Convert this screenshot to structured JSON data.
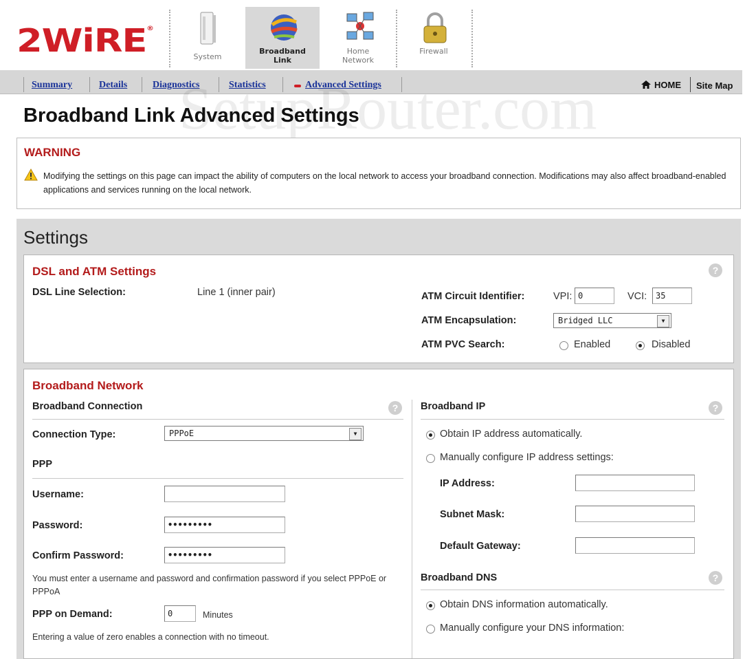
{
  "brand": {
    "logo_text": "2WiRE",
    "reg_mark": "®"
  },
  "main_nav": [
    {
      "label_line1": "System",
      "label_line2": ""
    },
    {
      "label_line1": "Broadband",
      "label_line2": "Link"
    },
    {
      "label_line1": "Home",
      "label_line2": "Network"
    },
    {
      "label_line1": "Firewall",
      "label_line2": ""
    }
  ],
  "sub_nav": {
    "items": [
      "Summary",
      "Details",
      "Diagnostics",
      "Statistics",
      "Advanced Settings"
    ],
    "home": "HOME",
    "site_map": "Site Map"
  },
  "watermark": "SetupRouter.com",
  "page_title": "Broadband Link Advanced Settings",
  "warning": {
    "title": "WARNING",
    "text": "Modifying the settings on this page can impact the ability of computers on the local network to access your broadband connection. Modifications may also affect broadband-enabled applications and services running on the local network."
  },
  "settings": {
    "title": "Settings",
    "dsl_atm": {
      "title": "DSL and ATM Settings",
      "line_selection_label": "DSL Line Selection:",
      "line_selection_value": "Line 1 (inner pair)",
      "atm_circuit_label": "ATM Circuit Identifier:",
      "vpi_label": "VPI:",
      "vpi_value": "0",
      "vci_label": "VCI:",
      "vci_value": "35",
      "encapsulation_label": "ATM Encapsulation:",
      "encapsulation_value": "Bridged LLC",
      "pvc_search_label": "ATM PVC Search:",
      "pvc_enabled": "Enabled",
      "pvc_disabled": "Disabled"
    },
    "broadband_network": {
      "title": "Broadband Network",
      "connection_header": "Broadband Connection",
      "connection_type_label": "Connection Type:",
      "connection_type_value": "PPPoE",
      "ppp_header": "PPP",
      "username_label": "Username:",
      "username_value": "",
      "password_label": "Password:",
      "password_value": "•••••••••",
      "confirm_label": "Confirm Password:",
      "confirm_value": "•••••••••",
      "ppp_note": "You must enter a username and password and confirmation password if you select PPPoE or PPPoA",
      "on_demand_label": "PPP on Demand:",
      "on_demand_value": "0",
      "on_demand_unit": "Minutes",
      "on_demand_note": "Entering a value of zero enables a connection with no timeout.",
      "ip_header": "Broadband IP",
      "ip_auto": "Obtain IP address automatically.",
      "ip_manual": "Manually configure IP address settings:",
      "ip_address_label": "IP Address:",
      "subnet_label": "Subnet Mask:",
      "gateway_label": "Default Gateway:",
      "dns_header": "Broadband DNS",
      "dns_auto": "Obtain DNS information automatically.",
      "dns_manual": "Manually configure your DNS information:"
    },
    "help_glyph": "?"
  }
}
